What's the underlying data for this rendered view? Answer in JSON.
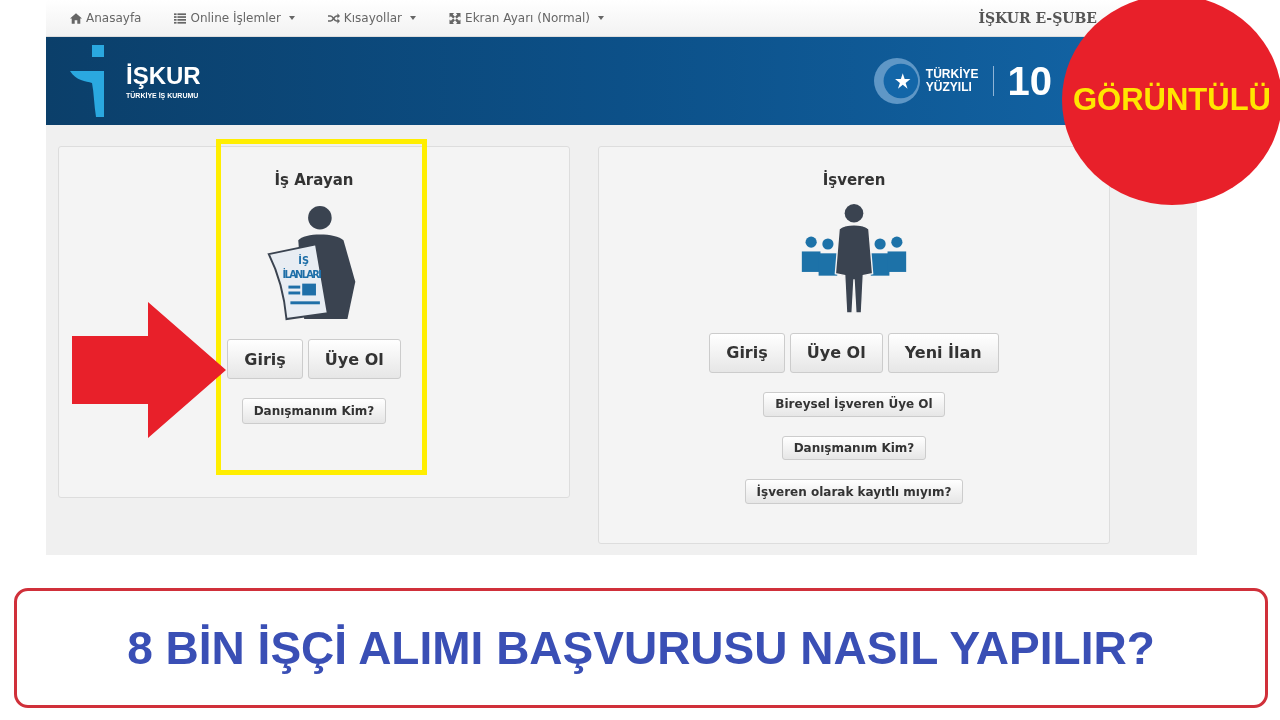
{
  "nav": {
    "items": [
      {
        "label": "Anasayfa",
        "dropdown": false
      },
      {
        "label": "Online İşlemler",
        "dropdown": true
      },
      {
        "label": "Kısayollar",
        "dropdown": true
      },
      {
        "label": "Ekran Ayarı (Normal)",
        "dropdown": true
      }
    ],
    "brand": "İŞKUR E-ŞUBE"
  },
  "banner": {
    "logo_title": "İŞKUR",
    "logo_subtitle": "TÜRKİYE İŞ KURUMU",
    "century_lines": [
      "TÜRKİYE",
      "YÜZYILI"
    ],
    "century_number": "10"
  },
  "panels": [
    {
      "title": "İş Arayan",
      "figure_text": [
        "İŞ",
        "İLANLARI"
      ],
      "main_buttons": [
        "Giriş",
        "Üye Ol"
      ],
      "extra_buttons": [
        "Danışmanım Kim?"
      ]
    },
    {
      "title": "İşveren",
      "main_buttons": [
        "Giriş",
        "Üye Ol",
        "Yeni İlan"
      ],
      "extra_buttons": [
        "Bireysel İşveren Üye Ol",
        "Danışmanım Kim?",
        "İşveren olarak kayıtlı mıyım?"
      ]
    }
  ],
  "annotations": {
    "badge": "GÖRÜNTÜLÜ",
    "headline": "8 BİN İŞÇİ ALIMI BAŞVURUSU NASIL YAPILIR?"
  }
}
